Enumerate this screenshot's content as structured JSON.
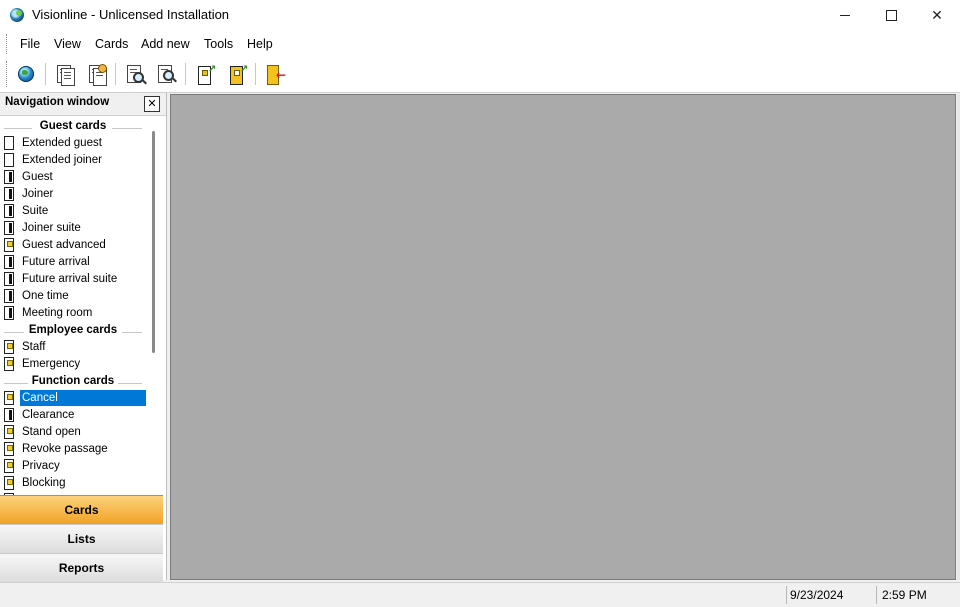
{
  "window": {
    "title": "Visionline - Unlicensed Installation"
  },
  "menu": [
    "File",
    "View",
    "Cards",
    "Add new",
    "Tools",
    "Help"
  ],
  "toolbar": {
    "icons": [
      "globe-icon",
      "document-list-icon",
      "document-user-icon",
      "search-document-icon",
      "find-icon",
      "new-card-icon",
      "copy-card-icon",
      "exit-door-icon"
    ]
  },
  "nav": {
    "title": "Navigation window",
    "sections": [
      {
        "title": "Guest cards",
        "items": [
          {
            "label": "Extended guest",
            "icon": "plain"
          },
          {
            "label": "Extended joiner",
            "icon": "plain"
          },
          {
            "label": "Guest",
            "icon": "bar"
          },
          {
            "label": "Joiner",
            "icon": "bar"
          },
          {
            "label": "Suite",
            "icon": "bar"
          },
          {
            "label": "Joiner suite",
            "icon": "bar"
          },
          {
            "label": "Guest advanced",
            "icon": "chip"
          },
          {
            "label": "Future arrival",
            "icon": "bar"
          },
          {
            "label": "Future arrival suite",
            "icon": "bar"
          },
          {
            "label": "One time",
            "icon": "bar"
          },
          {
            "label": "Meeting room",
            "icon": "bar"
          }
        ]
      },
      {
        "title": "Employee cards",
        "items": [
          {
            "label": "Staff",
            "icon": "chip"
          },
          {
            "label": "Emergency",
            "icon": "chip"
          }
        ]
      },
      {
        "title": "Function cards",
        "items": [
          {
            "label": "Cancel",
            "icon": "chip",
            "selected": true
          },
          {
            "label": "Clearance",
            "icon": "bar"
          },
          {
            "label": "Stand open",
            "icon": "chip"
          },
          {
            "label": "Revoke passage",
            "icon": "chip"
          },
          {
            "label": "Privacy",
            "icon": "chip"
          },
          {
            "label": "Blocking",
            "icon": "chip"
          }
        ]
      }
    ],
    "buttons": [
      {
        "label": "Cards",
        "active": true
      },
      {
        "label": "Lists",
        "active": false
      },
      {
        "label": "Reports",
        "active": false
      }
    ]
  },
  "status": {
    "date": "9/23/2024",
    "time": "2:59 PM"
  },
  "colors": {
    "selection": "#0078d7",
    "active_tab": "#f5b233",
    "workspace": "#aaaaaa"
  }
}
